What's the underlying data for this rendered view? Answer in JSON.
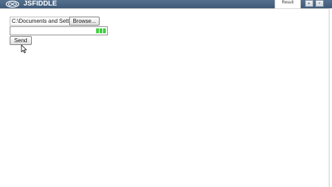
{
  "header": {
    "logo_text": "JSFIDDLE",
    "logo_icon": "jsfiddle-infinity-icon",
    "result_tab_label": "Result",
    "toolbar_buttons": [
      {
        "icon": "arrow-right-icon",
        "glyph": "▸"
      },
      {
        "icon": "plus-icon",
        "glyph": "+"
      }
    ]
  },
  "form": {
    "file_path_value": "C:\\Documents and Setti",
    "browse_label": "Browse...",
    "progress_fraction": 0.1,
    "send_label": "Send"
  },
  "colors": {
    "header": "#4a6684",
    "progress": "#3fcf3f"
  }
}
